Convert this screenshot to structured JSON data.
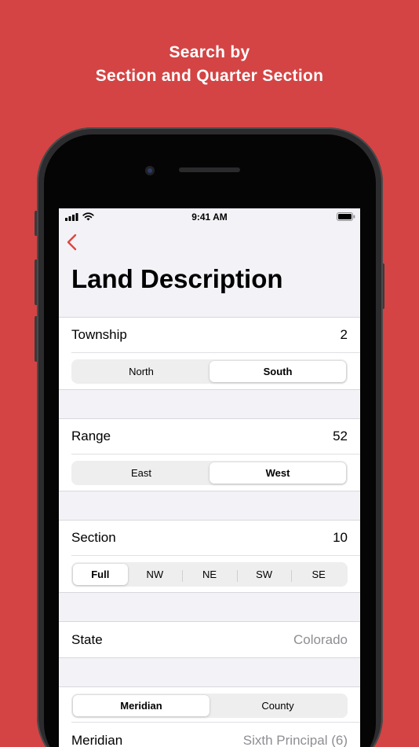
{
  "promo": {
    "line1": "Search by",
    "line2": "Section and Quarter Section"
  },
  "status_bar": {
    "time": "9:41 AM"
  },
  "page": {
    "title": "Land Description"
  },
  "township": {
    "label": "Township",
    "value": "2",
    "options": [
      "North",
      "South"
    ],
    "selected": "South"
  },
  "range": {
    "label": "Range",
    "value": "52",
    "options": [
      "East",
      "West"
    ],
    "selected": "West"
  },
  "section": {
    "label": "Section",
    "value": "10",
    "options": [
      "Full",
      "NW",
      "NE",
      "SW",
      "SE"
    ],
    "selected": "Full"
  },
  "state": {
    "label": "State",
    "value": "Colorado"
  },
  "lookup": {
    "options": [
      "Meridian",
      "County"
    ],
    "selected": "Meridian"
  },
  "meridian": {
    "label": "Meridian",
    "value": "Sixth Principal (6)"
  },
  "colors": {
    "background": "#D44444",
    "accent": "#E0463F",
    "screen_bg": "#F2F2F7"
  }
}
